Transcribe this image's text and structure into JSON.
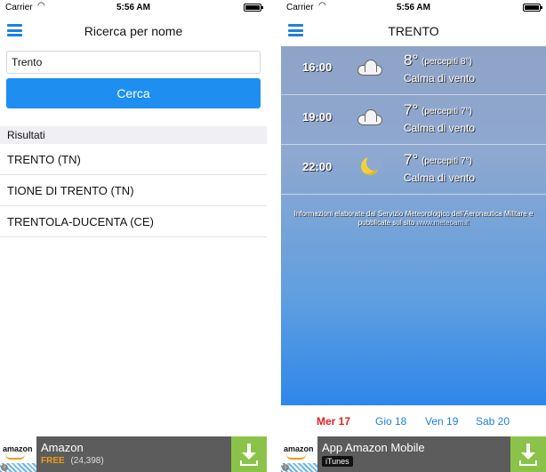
{
  "left": {
    "status": {
      "carrier": "Carrier",
      "time": "5:56 AM"
    },
    "title": "Ricerca per nome",
    "search": {
      "value": "Trento"
    },
    "search_button": "Cerca",
    "results_header": "Risultati",
    "results": [
      "TRENTO (TN)",
      "TIONE DI TRENTO (TN)",
      "TRENTOLA-DUCENTA (CE)"
    ],
    "ad": {
      "logo": "amazon",
      "title": "Amazon",
      "free": "FREE",
      "rating": "(24,398)"
    }
  },
  "right": {
    "status": {
      "carrier": "Carrier",
      "time": "5:56 AM"
    },
    "title": "TRENTO",
    "forecasts": [
      {
        "time": "16:00",
        "icon": "cloud-icon",
        "temp": "8°",
        "perceived": "(percepiti 8°)",
        "wind": "Calma di vento"
      },
      {
        "time": "19:00",
        "icon": "cloud-icon",
        "temp": "7°",
        "perceived": "(percepiti 7°)",
        "wind": "Calma di vento"
      },
      {
        "time": "22:00",
        "icon": "moon-icon",
        "temp": "7°",
        "perceived": "(percepiti 7°)",
        "wind": "Calma di vento"
      }
    ],
    "info_text_1": "Informazioni elaborate dal Servizio Meteorologico dell'Aeronautica Militare e",
    "info_text_2": "pubblicate sul sito",
    "info_link": "www.meteoam.it",
    "days": [
      {
        "label": "Mer 17",
        "active": true
      },
      {
        "label": "Gio 18",
        "active": false
      },
      {
        "label": "Ven 19",
        "active": false
      },
      {
        "label": "Sab 20",
        "active": false
      }
    ],
    "ad": {
      "logo": "amazon",
      "title": "App Amazon Mobile",
      "badge": "iTunes"
    }
  },
  "colors": {
    "accent": "#1e8ff0",
    "active_day": "#e2231a",
    "download": "#8bc34a"
  }
}
